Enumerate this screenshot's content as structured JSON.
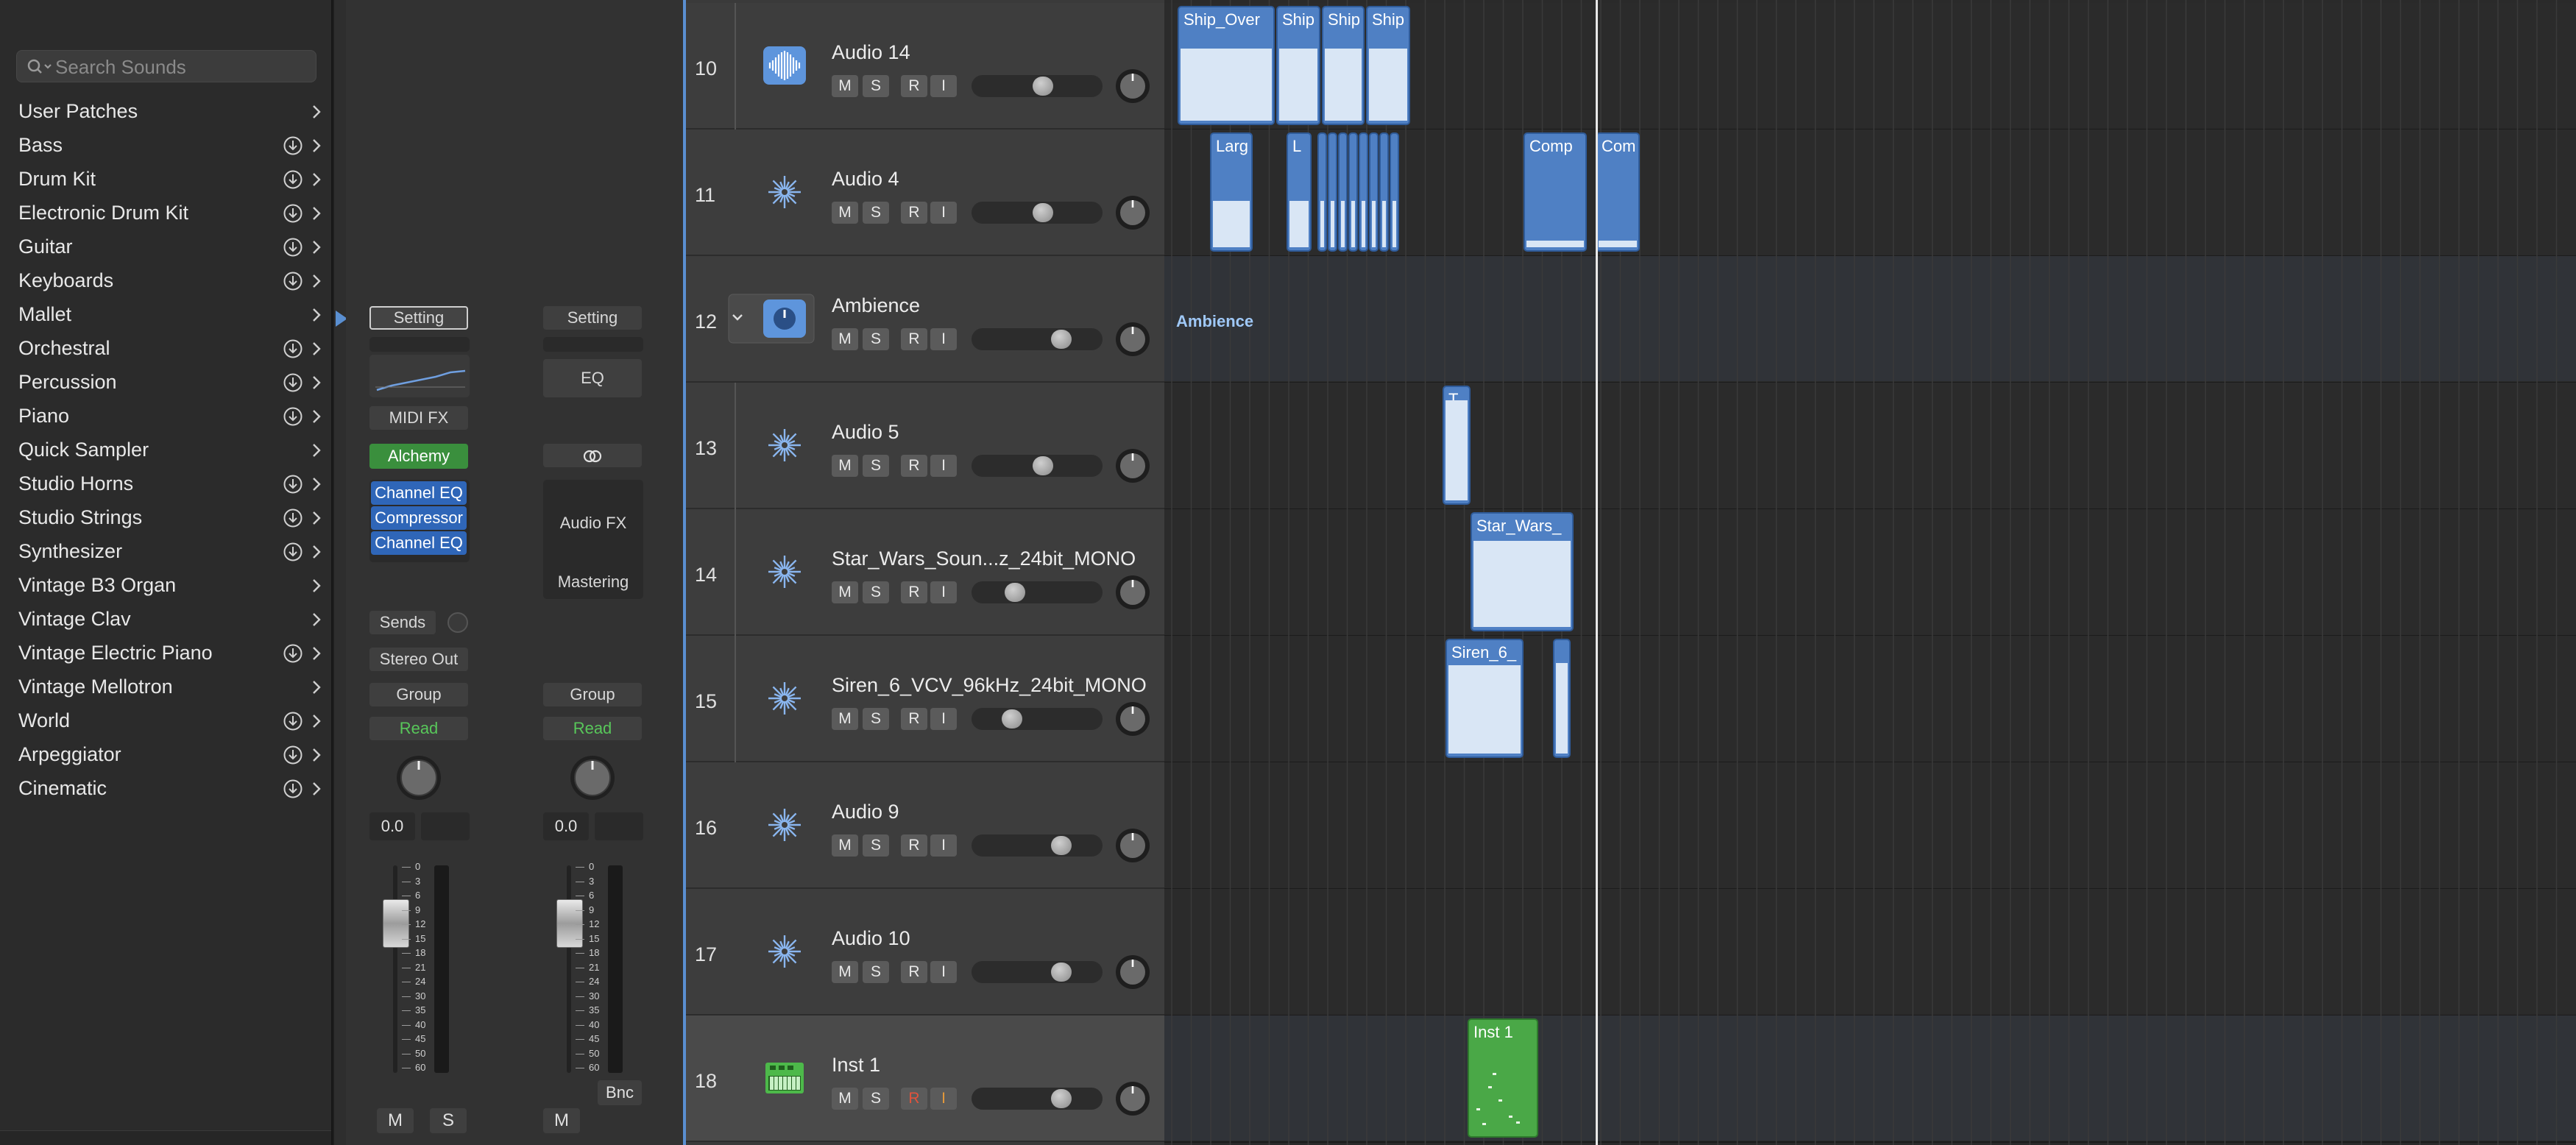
{
  "library": {
    "search_placeholder": "Search Sounds",
    "items": [
      {
        "label": "User Patches",
        "download": false
      },
      {
        "label": "Bass",
        "download": true
      },
      {
        "label": "Drum Kit",
        "download": true
      },
      {
        "label": "Electronic Drum Kit",
        "download": true
      },
      {
        "label": "Guitar",
        "download": true
      },
      {
        "label": "Keyboards",
        "download": true
      },
      {
        "label": "Mallet",
        "download": false
      },
      {
        "label": "Orchestral",
        "download": true
      },
      {
        "label": "Percussion",
        "download": true
      },
      {
        "label": "Piano",
        "download": true
      },
      {
        "label": "Quick Sampler",
        "download": false
      },
      {
        "label": "Studio Horns",
        "download": true
      },
      {
        "label": "Studio Strings",
        "download": true
      },
      {
        "label": "Synthesizer",
        "download": true
      },
      {
        "label": "Vintage B3 Organ",
        "download": false
      },
      {
        "label": "Vintage Clav",
        "download": false
      },
      {
        "label": "Vintage Electric Piano",
        "download": true
      },
      {
        "label": "Vintage Mellotron",
        "download": false
      },
      {
        "label": "World",
        "download": true
      },
      {
        "label": "Arpeggiator",
        "download": true
      },
      {
        "label": "Cinematic",
        "download": true
      }
    ]
  },
  "strip_left": {
    "setting": "Setting",
    "midi_fx": "MIDI FX",
    "instrument": "Alchemy",
    "plugins": [
      "Channel EQ",
      "Compressor",
      "Channel EQ"
    ],
    "sends": "Sends",
    "output": "Stereo Out",
    "group": "Group",
    "automation": "Read",
    "volume_value": "0.0",
    "mute": "M",
    "solo": "S"
  },
  "strip_right": {
    "setting": "Setting",
    "eq": "EQ",
    "audio_fx": "Audio FX",
    "mastering": "Mastering",
    "group": "Group",
    "automation": "Read",
    "volume_value": "0.0",
    "mute": "M",
    "bounce": "Bnc"
  },
  "fader_scale": [
    "0",
    "3",
    "6",
    "9",
    "12",
    "15",
    "18",
    "21",
    "24",
    "30",
    "35",
    "40",
    "45",
    "50",
    "60"
  ],
  "track_buttons": {
    "mute": "M",
    "solo": "S",
    "record": "R",
    "input": "I"
  },
  "tracks": [
    {
      "number": "10",
      "name": "Audio 14",
      "icon": "waveform-icon",
      "volume": 0.55
    },
    {
      "number": "11",
      "name": "Audio 4",
      "icon": "starburst-icon",
      "volume": 0.55
    },
    {
      "number": "12",
      "name": "Ambience",
      "icon": "summing-stack-icon",
      "volume": 0.72
    },
    {
      "number": "13",
      "name": "Audio 5",
      "icon": "starburst-icon",
      "volume": 0.55
    },
    {
      "number": "14",
      "name": "Star_Wars_Soun...z_24bit_MONO",
      "icon": "starburst-icon",
      "volume": 0.3
    },
    {
      "number": "15",
      "name": "Siren_6_VCV_96kHz_24bit_MONO",
      "icon": "starburst-icon",
      "volume": 0.27
    },
    {
      "number": "16",
      "name": "Audio 9",
      "icon": "starburst-icon",
      "volume": 0.72
    },
    {
      "number": "17",
      "name": "Audio 10",
      "icon": "starburst-icon",
      "volume": 0.72
    },
    {
      "number": "18",
      "name": "Inst 1",
      "icon": "keyboard-icon",
      "volume": 0.72
    }
  ],
  "regions": {
    "row10": [
      "Ship_Over",
      "Ship",
      "Ship",
      "Ship"
    ],
    "row11": [
      "Larg",
      "L",
      "Comp",
      "Com"
    ],
    "row12_label": "Ambience",
    "row13": [
      "T"
    ],
    "row14": [
      "Star_Wars_"
    ],
    "row15": [
      "Siren_6_"
    ],
    "row18": [
      "Inst 1"
    ]
  },
  "colors": {
    "audio_region": "#4f80c4",
    "midi_region": "#4aa847",
    "accent": "#5a8fd1",
    "automation_read": "#58c75a",
    "instrument_slot": "#3a8f3d"
  }
}
